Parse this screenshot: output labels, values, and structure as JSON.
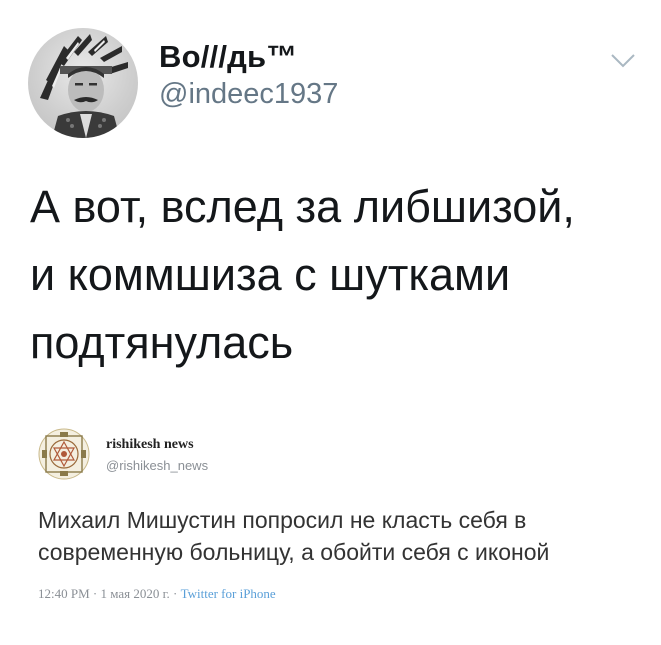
{
  "tweet": {
    "author": {
      "display_name": "Во///дь™",
      "handle": "@indeec1937",
      "avatar_icon": "profile-avatar-portrait"
    },
    "menu_icon": "chevron-down-icon",
    "text_lines": [
      "А вот, вслед за либшизой,",
      "и коммшиза с шутками",
      "подтянулась"
    ]
  },
  "quoted_tweet": {
    "author": {
      "display_name": "rishikesh news",
      "handle": "@rishikesh_news",
      "avatar_icon": "mandala-logo-icon"
    },
    "text_lines": [
      "Михаил Мишустин попросил не класть себя в",
      "современную больницу, а обойти себя с иконой"
    ],
    "meta": {
      "time_date": "12:40 PM · 1 мая 2020 г. · ",
      "source": "Twitter for iPhone"
    }
  },
  "colors": {
    "text_primary": "#14171a",
    "text_secondary": "#657786",
    "link": "#5a9fd8"
  }
}
